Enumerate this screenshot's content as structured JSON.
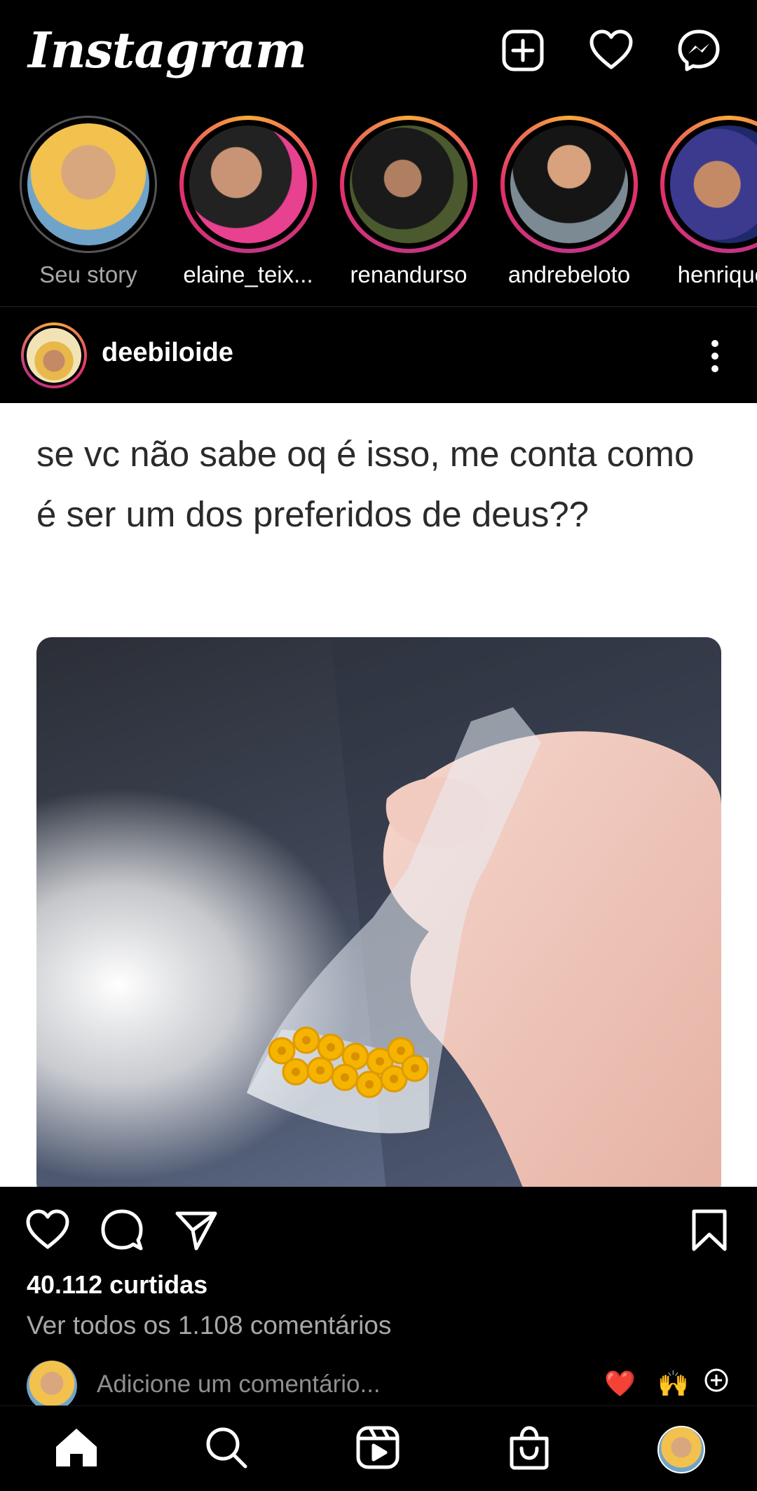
{
  "header": {
    "logo": "Instagram",
    "icons": [
      "new-post-icon",
      "heart-icon",
      "messenger-icon"
    ]
  },
  "stories": [
    {
      "name": "Seu story",
      "own": true
    },
    {
      "name": "elaine_teix...",
      "own": false
    },
    {
      "name": "renandurso",
      "own": false
    },
    {
      "name": "andrebeloto",
      "own": false
    },
    {
      "name": "henriqueg",
      "own": false
    }
  ],
  "post": {
    "username": "deebiloide",
    "caption_image_text": "se vc não sabe oq é isso, me conta como é ser um dos preferidos de deus??",
    "likes": "40.112 curtidas",
    "view_comments": "Ver todos os 1.108 comentários",
    "comment_placeholder": "Adicione um comentário...",
    "quick_emojis": [
      "❤️",
      "🙌"
    ]
  },
  "colors": {
    "background": "#000000",
    "secondary_text": "#a8a8a8",
    "story_ring_start": "#f8a93b",
    "story_ring_end": "#c13584"
  },
  "nav": [
    "home-icon",
    "search-icon",
    "reels-icon",
    "shop-icon",
    "profile-avatar"
  ]
}
